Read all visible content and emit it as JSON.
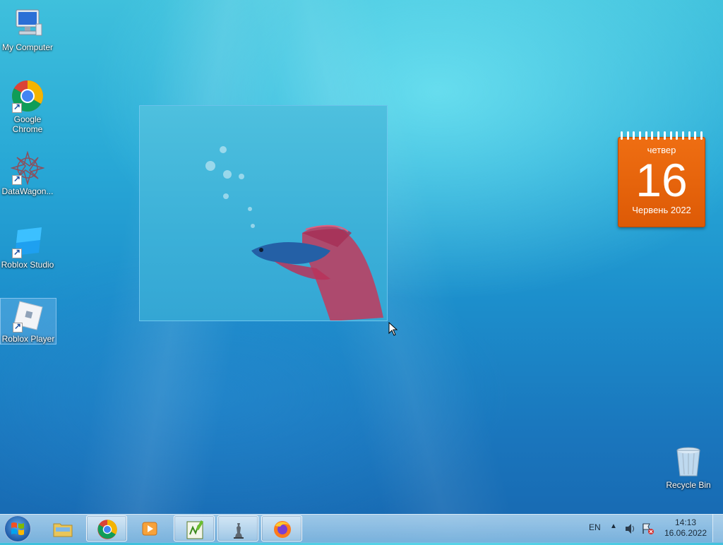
{
  "desktop": {
    "icons": [
      {
        "label": "My Computer",
        "icon": "computer-icon"
      },
      {
        "label": "Google\nChrome",
        "icon": "chrome-icon"
      },
      {
        "label": "DataWagon...",
        "icon": "datawagon-icon"
      },
      {
        "label": "Roblox Studio",
        "icon": "roblox-studio-icon"
      },
      {
        "label": "Roblox Player",
        "icon": "roblox-player-icon"
      },
      {
        "label": "Recycle Bin",
        "icon": "recycle-bin-icon"
      }
    ]
  },
  "calendar_gadget": {
    "day_name": "четвер",
    "day_number": "16",
    "month_year": "Червень 2022",
    "color": "#e8650c"
  },
  "taskbar": {
    "apps": [
      {
        "name": "Windows Explorer",
        "icon": "folder-icon"
      },
      {
        "name": "Google Chrome",
        "icon": "chrome-icon"
      },
      {
        "name": "Media Player",
        "icon": "media-player-icon"
      },
      {
        "name": "Notepad++",
        "icon": "notepad-icon"
      },
      {
        "name": "Chess",
        "icon": "chess-icon"
      },
      {
        "name": "Firefox",
        "icon": "firefox-icon"
      }
    ],
    "language": "EN",
    "time": "14:13",
    "date": "16.06.2022"
  }
}
